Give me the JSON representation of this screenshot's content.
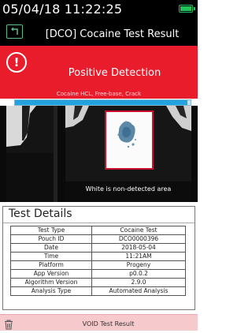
{
  "status": {
    "datetime": "05/04/18  11:22:25",
    "battery_icon": "battery-full-icon"
  },
  "header": {
    "title": "[DCO] Cocaine Test Result",
    "back_icon": "back-icon"
  },
  "alert": {
    "title": "Positive Detection",
    "subtitle": "Cocaine HCL, Free-base, Crack",
    "icon": "exclamation-icon",
    "color": "#e81c2b"
  },
  "progress": {
    "fraction": 0.98
  },
  "camera": {
    "caption": "White is non-detected area"
  },
  "details": {
    "title": "Test Details",
    "rows": [
      {
        "key": "Test Type",
        "value": "Cocaine Test"
      },
      {
        "key": "Pouch ID",
        "value": "DCO0000396"
      },
      {
        "key": "Date",
        "value": "2018-05-04"
      },
      {
        "key": "Time",
        "value": "11:21AM"
      },
      {
        "key": "Platform",
        "value": "Progeny"
      },
      {
        "key": "App Version",
        "value": "p0.0.2"
      },
      {
        "key": "Algorithm Version",
        "value": "2.9.0"
      },
      {
        "key": "Analysis Type",
        "value": "Automated Analysis"
      }
    ]
  },
  "void": {
    "label": "VOID Test Result",
    "icon": "trash-icon"
  }
}
